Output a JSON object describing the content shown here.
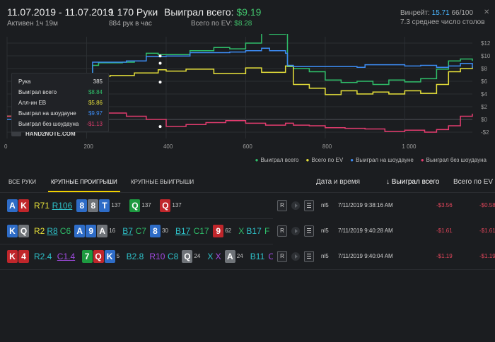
{
  "header": {
    "date_range": "11.07.2019 - 11.07.2019",
    "active": "Активен 1ч 19м",
    "hands": "1 170 Руки",
    "hands_per_hour": "884 рук в час",
    "won_label": "Выиграл всего:",
    "won_value": "$9.19",
    "ev_label": "Всего по EV:",
    "ev_value": "$8.28",
    "vpip_label": "Винрейт:",
    "vpip_value": "15.71",
    "vpip_rest": "66/100",
    "tables": "7.3 среднее число столов"
  },
  "chart_data": {
    "type": "line",
    "x_ticks": [
      "0",
      "200",
      "400",
      "600",
      "800",
      "1 000"
    ],
    "y_ticks": [
      "$12",
      "$10",
      "$8",
      "$6",
      "$4",
      "$2",
      "$0",
      "-$2"
    ],
    "xlim": [
      0,
      1170
    ],
    "ylim": [
      -3,
      13
    ],
    "grid": true,
    "legend_position": "bottom-right",
    "watermark": "HAND2NOTE.COM",
    "series": [
      {
        "name": "Выиграл всего",
        "color": "#2fbf6a",
        "x": [
          0,
          30,
          60,
          90,
          130,
          200,
          215,
          230,
          290,
          320,
          350,
          380,
          400,
          460,
          520,
          560,
          600,
          640,
          660,
          700,
          705,
          720,
          760,
          800,
          840,
          880,
          920,
          960,
          1000,
          1040,
          1080,
          1110,
          1140,
          1170
        ],
        "y": [
          0.5,
          1.5,
          2.1,
          3.5,
          4.2,
          5.1,
          8.5,
          8.9,
          9.0,
          9.2,
          10.4,
          10.2,
          10.2,
          10.8,
          11.3,
          11.1,
          12.0,
          13.6,
          13.4,
          13.5,
          8.3,
          8.0,
          7.5,
          6.2,
          5.8,
          6.0,
          5.5,
          6.2,
          5.9,
          6.4,
          7.9,
          9.2,
          9.5,
          9.2
        ]
      },
      {
        "name": "Всего по EV",
        "color": "#e8e23a",
        "x": [
          0,
          60,
          100,
          150,
          200,
          215,
          260,
          320,
          380,
          400,
          450,
          520,
          600,
          640,
          700,
          720,
          760,
          800,
          840,
          880,
          920,
          960,
          1000,
          1040,
          1080,
          1110,
          1140,
          1170
        ],
        "y": [
          0.5,
          2.2,
          3.4,
          4.5,
          2.4,
          6.8,
          6.9,
          7.3,
          7.8,
          7.6,
          7.9,
          7.2,
          8.1,
          7.4,
          8.4,
          5.5,
          4.9,
          3.9,
          4.5,
          4.0,
          4.3,
          4.0,
          4.5,
          4.1,
          5.5,
          7.5,
          8.0,
          8.3
        ]
      },
      {
        "name": "Выиграл на шоудауне",
        "color": "#3c8bf2",
        "x": [
          0,
          100,
          200,
          215,
          300,
          350,
          400,
          460,
          560,
          600,
          640,
          660,
          700,
          705,
          720,
          880,
          900,
          1000,
          1040,
          1080,
          1110,
          1140,
          1170
        ],
        "y": [
          0.0,
          1.0,
          1.8,
          9.0,
          9.2,
          9.9,
          9.97,
          10.5,
          10.6,
          10.8,
          11.2,
          10.8,
          10.4,
          8.5,
          8.3,
          8.2,
          8.6,
          8.4,
          8.5,
          8.2,
          8.4,
          8.8,
          8.1
        ]
      },
      {
        "name": "Выиграл без шоудауна",
        "color": "#e23c6e",
        "x": [
          0,
          60,
          100,
          150,
          200,
          250,
          300,
          350,
          400,
          450,
          500,
          550,
          600,
          650,
          700,
          720,
          760,
          800,
          850,
          900,
          950,
          1000,
          1050,
          1080,
          1110,
          1140,
          1170
        ],
        "y": [
          0.5,
          1.0,
          1.8,
          2.6,
          1.5,
          1.0,
          0.5,
          0.0,
          -1.1,
          -0.8,
          -0.5,
          -0.2,
          -0.6,
          -0.9,
          -0.6,
          -0.9,
          -1.0,
          -1.3,
          -1.4,
          -1.5,
          -1.9,
          -1.7,
          -2.0,
          -1.6,
          -1.0,
          0.5,
          0.9
        ]
      }
    ]
  },
  "tooltip": {
    "rows": [
      {
        "label": "Рука",
        "value": "385",
        "color": "#e0e0e0"
      },
      {
        "label": "Выиграл всего",
        "value": "$8.84",
        "color": "#2fbf6a"
      },
      {
        "label": "Алл-ин EB",
        "value": "$5.86",
        "color": "#e8e23a"
      },
      {
        "label": "Выиграл на шоудауне",
        "value": "$9.97",
        "color": "#3c8bf2"
      },
      {
        "label": "Выиграл без шоудауна",
        "value": "-$1.13",
        "color": "#e23c6e"
      }
    ]
  },
  "tabs": [
    {
      "label": "ВСЕ РУКИ"
    },
    {
      "label": "КРУПНЫЕ ПРОИГРЫШИ"
    },
    {
      "label": "КРУПНЫЕ ВЫИГРЫШИ"
    }
  ],
  "columns": {
    "date": "Дата и время",
    "won": "↓ Выиграл всего",
    "ev": "Всего по EV"
  },
  "hands": [
    {
      "cards": [
        {
          "r": "A",
          "c": "blue"
        },
        {
          "r": "K",
          "c": "red"
        }
      ],
      "actions": [
        {
          "t": "R71",
          "c": "#e8e23a"
        },
        {
          "t": "R106",
          "c": "#2ec0c8",
          "u": true
        }
      ],
      "groups": [
        {
          "cards": [
            {
              "r": "8",
              "c": "blue"
            },
            {
              "r": "8",
              "c": "grey"
            },
            {
              "r": "T",
              "c": "blue"
            }
          ],
          "n": "137"
        },
        {
          "cards": [
            {
              "r": "Q",
              "c": "green"
            }
          ],
          "n": "137"
        },
        {
          "cards": [
            {
              "r": "Q",
              "c": "red"
            }
          ],
          "n": "137"
        }
      ],
      "site": "nl5",
      "date": "7/11/2019 9:38:16 AM",
      "won": "-$3.56",
      "ev": "-$0.58"
    },
    {
      "cards": [
        {
          "r": "K",
          "c": "blue"
        },
        {
          "r": "Q",
          "c": "grey"
        }
      ],
      "actions": [
        {
          "t": "R2",
          "c": "#e8e23a"
        },
        {
          "t": "R8",
          "c": "#2ec0c8",
          "u": true
        },
        {
          "t": "C6",
          "c": "#2fbf6a"
        }
      ],
      "groups": [
        {
          "cards": [
            {
              "r": "A",
              "c": "blue"
            },
            {
              "r": "9",
              "c": "blue"
            },
            {
              "r": "A",
              "c": "grey"
            }
          ],
          "n": "16",
          "acts": [
            {
              "t": "B7",
              "c": "#2ec0c8",
              "u": true
            },
            {
              "t": "C7",
              "c": "#2fbf6a"
            }
          ]
        },
        {
          "cards": [
            {
              "r": "8",
              "c": "blue"
            }
          ],
          "n": "30",
          "acts": [
            {
              "t": "B17",
              "c": "#2ec0c8",
              "u": true
            },
            {
              "t": "C17",
              "c": "#2fbf6a"
            }
          ]
        },
        {
          "cards": [
            {
              "r": "9",
              "c": "red"
            }
          ],
          "n": "62",
          "acts": [
            {
              "t": "X",
              "c": "#2fbf6a"
            },
            {
              "t": "B17",
              "c": "#2ec0c8"
            },
            {
              "t": "F",
              "c": "#2fbf6a"
            }
          ]
        }
      ],
      "site": "nl5",
      "date": "7/11/2019 9:40:28 AM",
      "won": "-$1.61",
      "ev": "-$1.61"
    },
    {
      "cards": [
        {
          "r": "K",
          "c": "red"
        },
        {
          "r": "4",
          "c": "red"
        }
      ],
      "actions": [
        {
          "t": "R2.4",
          "c": "#2ec0c8"
        },
        {
          "t": "C1.4",
          "c": "#a14be0",
          "u": true
        }
      ],
      "groups": [
        {
          "cards": [
            {
              "r": "7",
              "c": "green"
            },
            {
              "r": "Q",
              "c": "red"
            },
            {
              "r": "K",
              "c": "blue"
            }
          ],
          "n": "5",
          "acts": [
            {
              "t": "B2.8",
              "c": "#2ec0c8"
            },
            {
              "t": "R10",
              "c": "#a14be0"
            },
            {
              "t": "C8",
              "c": "#2ec0c8"
            }
          ]
        },
        {
          "cards": [
            {
              "r": "Q",
              "c": "grey"
            }
          ],
          "n": "24",
          "acts": [
            {
              "t": "X",
              "c": "#2ec0c8"
            },
            {
              "t": "X",
              "c": "#a14be0"
            }
          ]
        },
        {
          "cards": [
            {
              "r": "A",
              "c": "grey"
            }
          ],
          "n": "24",
          "acts": [
            {
              "t": "B11",
              "c": "#2ec0c8"
            },
            {
              "t": "C",
              "c": "#a14be0"
            }
          ]
        }
      ],
      "site": "nl5",
      "date": "7/11/2019 9:40:04 AM",
      "won": "-$1.19",
      "ev": "-$1.19"
    }
  ]
}
